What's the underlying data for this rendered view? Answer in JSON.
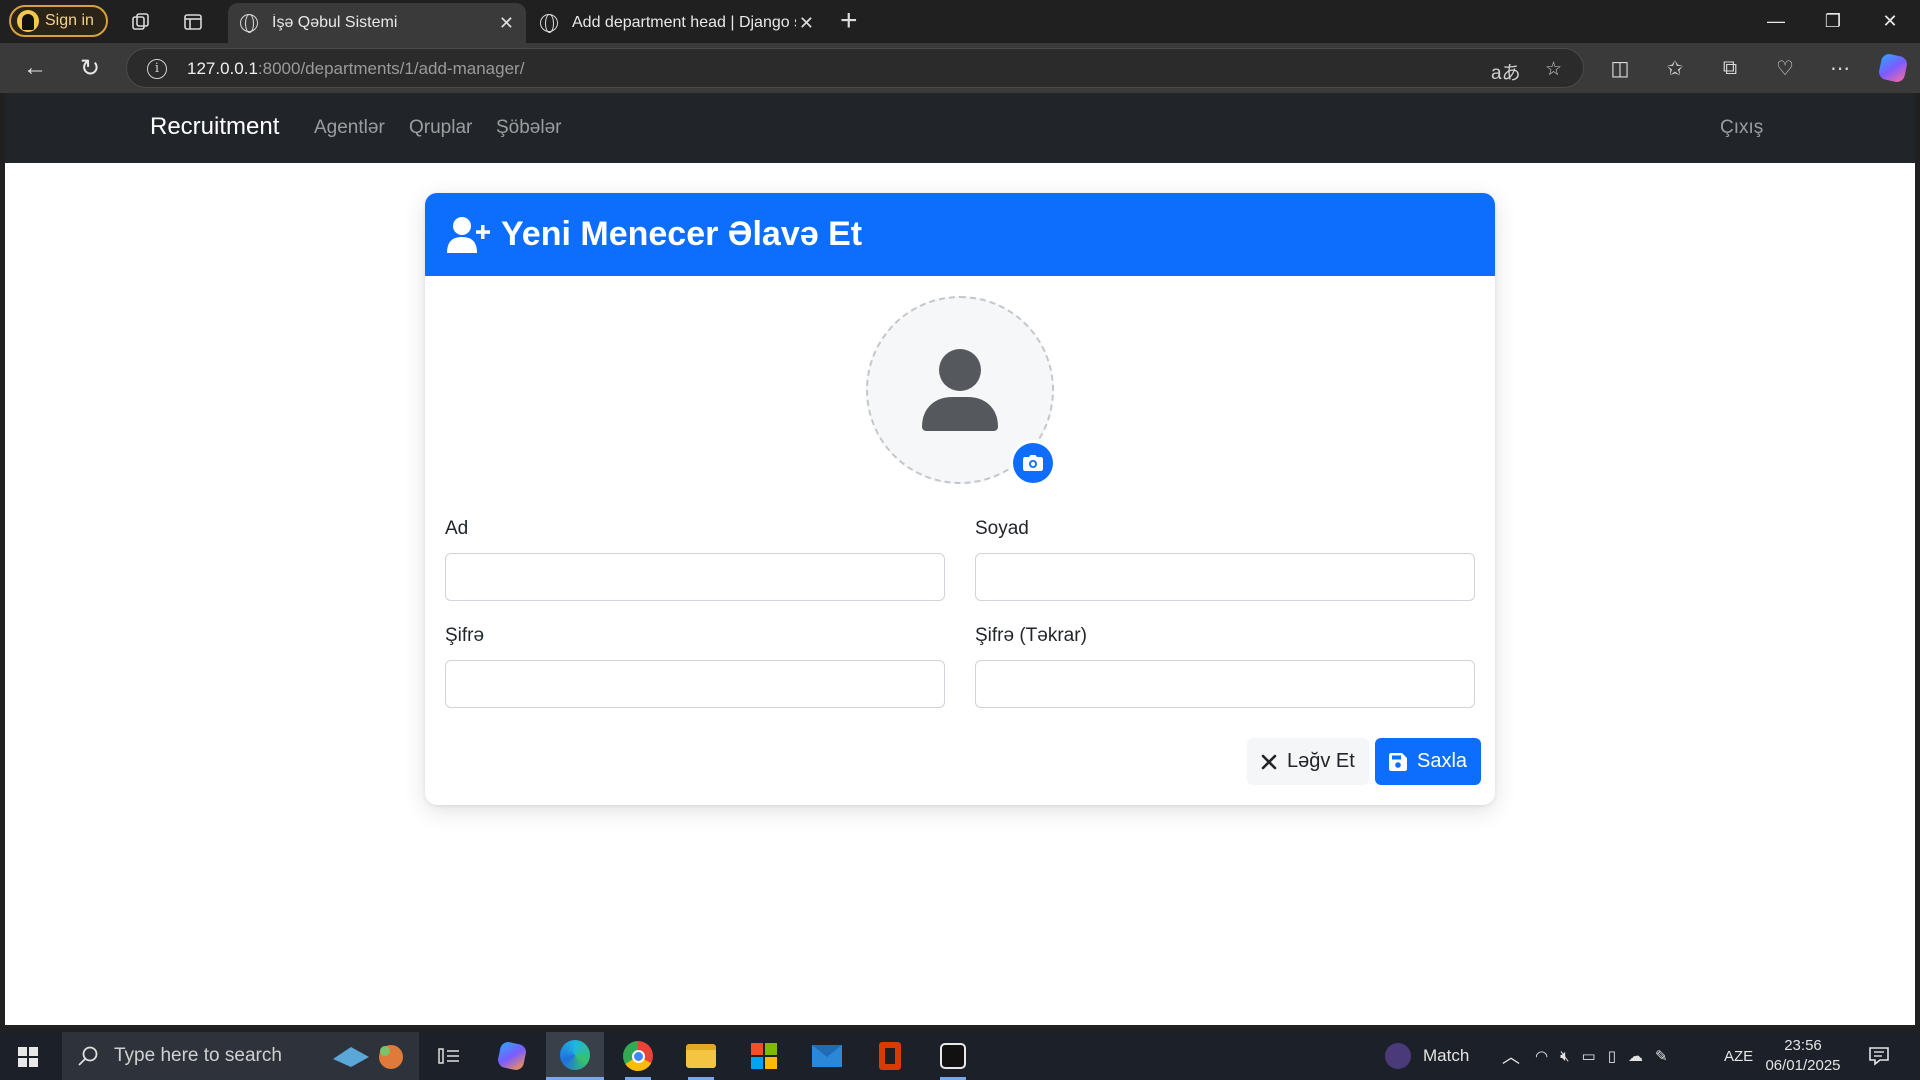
{
  "browser": {
    "sign_in": "Sign in",
    "tabs": [
      {
        "title": "İşə Qəbul Sistemi",
        "active": true
      },
      {
        "title": "Add department head | Django si",
        "active": false
      }
    ],
    "url_host": "127.0.0.1",
    "url_rest": ":8000/departments/1/add-manager/"
  },
  "navbar": {
    "brand": "Recruitment",
    "links": [
      "Agentlər",
      "Qruplar",
      "Şöbələr"
    ],
    "logout": "Çıxış"
  },
  "form": {
    "title": "Yeni Menecer Əlavə Et",
    "fields": {
      "first_name": {
        "label": "Ad",
        "value": ""
      },
      "last_name": {
        "label": "Soyad",
        "value": ""
      },
      "password": {
        "label": "Şifrə",
        "value": ""
      },
      "password_confirm": {
        "label": "Şifrə (Təkrar)",
        "value": ""
      }
    },
    "cancel_label": "Ləğv Et",
    "save_label": "Saxla"
  },
  "taskbar": {
    "search_placeholder": "Type here to search",
    "weather": "Match",
    "language": "AZE",
    "time": "23:56",
    "date": "06/01/2025"
  },
  "colors": {
    "primary": "#0d6efd",
    "navbar": "#212529"
  }
}
